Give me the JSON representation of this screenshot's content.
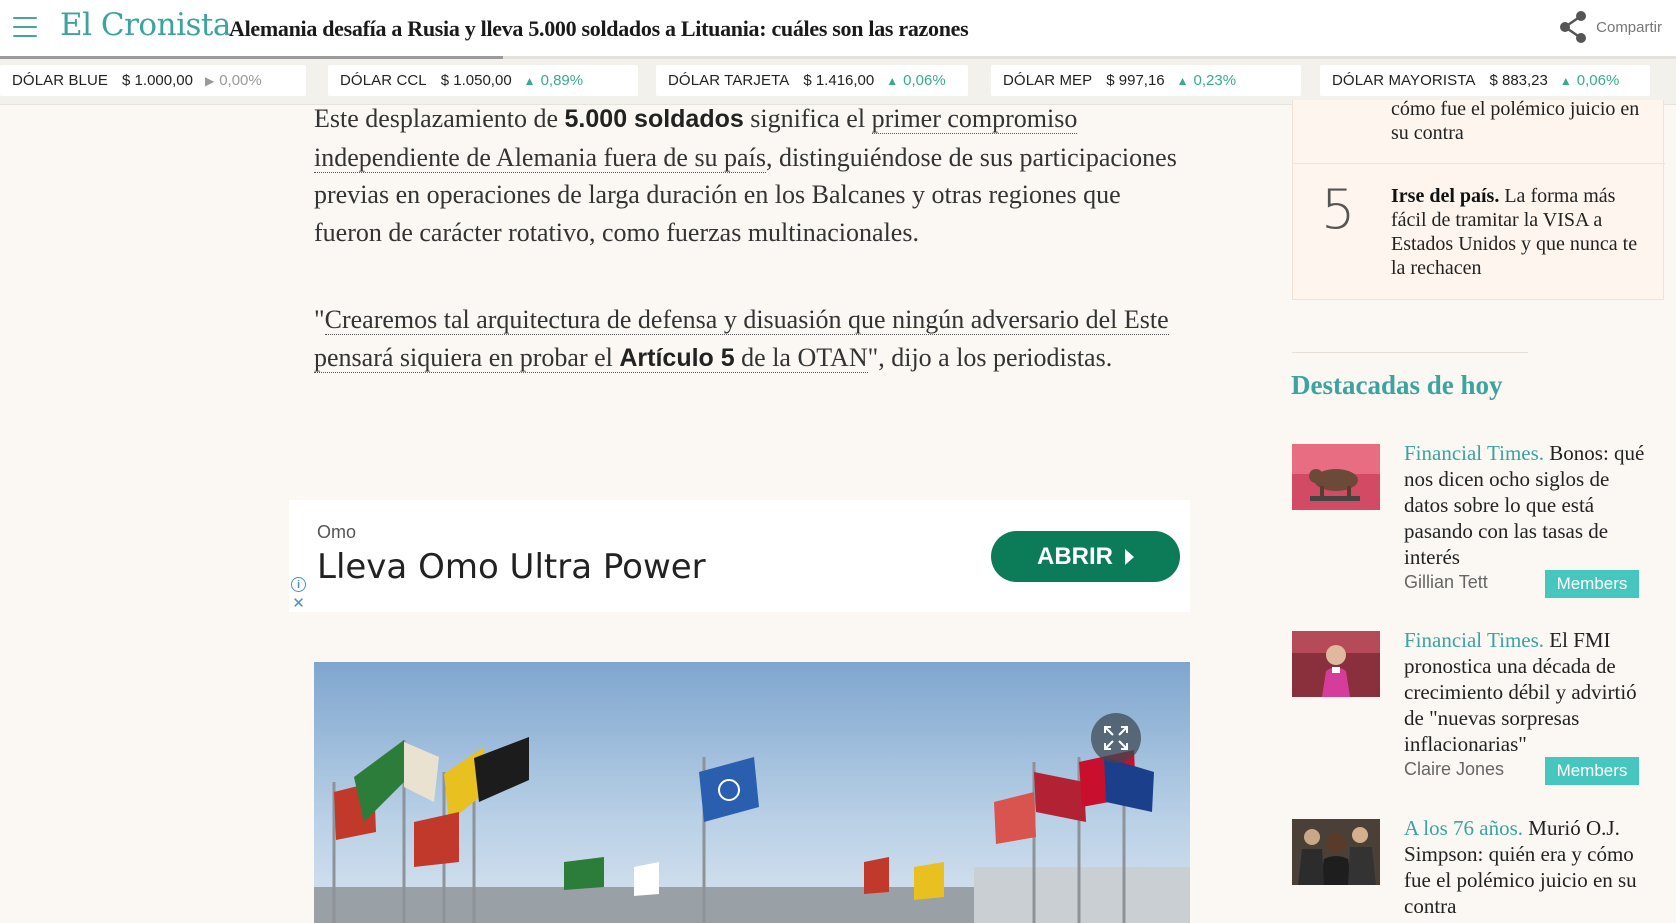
{
  "header": {
    "logo": "El Cronista",
    "headline": "Alemania desafía a Rusia y lleva 5.000 soldados a Lituania: cuáles son las razones",
    "share_label": "Compartir",
    "reading_progress_percent": 30
  },
  "ticker": [
    {
      "name": "DÓLAR BLUE",
      "value": "$ 1.000,00",
      "change": "0,00%",
      "direction": "flat"
    },
    {
      "name": "DÓLAR CCL",
      "value": "$ 1.050,00",
      "change": "0,89%",
      "direction": "up"
    },
    {
      "name": "DÓLAR TARJETA",
      "value": "$ 1.416,00",
      "change": "0,06%",
      "direction": "up"
    },
    {
      "name": "DÓLAR MEP",
      "value": "$ 997,16",
      "change": "0,23%",
      "direction": "up"
    },
    {
      "name": "DÓLAR MAYORISTA",
      "value": "$ 883,23",
      "change": "0,06%",
      "direction": "up"
    }
  ],
  "article": {
    "p1_a": "Este desplazamiento de ",
    "p1_b": "5.000 soldados",
    "p1_c": " significa el ",
    "p1_link": "primer compromiso independiente de Alemania fuera de su país",
    "p1_d": ", distinguiéndose de sus participaciones previas en operaciones de larga duración en los Balcanes y otras regiones que fueron de carácter rotativo, como fuerzas multinacionales.",
    "p2_q": "\"",
    "p2_link_a": "Crearemos tal arquitectura de defensa y disuasión que ningún adversario del Este pensará siquiera en probar el ",
    "p2_link_b": "Artículo 5",
    "p2_link_c": " de la OTAN",
    "p2_d": "\", dijo a los periodistas."
  },
  "ad": {
    "brand": "Omo",
    "title": "Lleva Omo Ultra Power",
    "button": "ABRIR",
    "info": "i",
    "close": "✕"
  },
  "sidebar": {
    "prev_item_tail": "cómo fue el polémico juicio en su contra",
    "item5_number": "5",
    "item5_bold": "Irse del país.",
    "item5_text": " La forma más fácil de tramitar la VISA a Estados Unidos y que nunca te la rechacen",
    "destacadas_title": "Destacadas de hoy",
    "stories": [
      {
        "source": "Financial Times.",
        "text": " Bonos: qué nos dicen ocho siglos de datos sobre lo que está pasando con las tasas de interés",
        "author": "Gillian Tett",
        "badge": "Members"
      },
      {
        "source": "Financial Times.",
        "text": " El FMI pronostica una década de crecimiento débil y advirtió de \"nuevas sorpresas inflacionarias\"",
        "author": "Claire Jones",
        "badge": "Members"
      },
      {
        "source": "A los 76 años.",
        "text": " Murió O.J. Simpson: quién era y cómo fue el polémico juicio en su contra"
      }
    ]
  },
  "colors": {
    "brand_teal": "#3ca39f",
    "ticker_up": "#3aaa8e",
    "ad_button": "#0c7c58",
    "members_badge": "#47c6bf"
  },
  "icons": [
    "menu-icon",
    "share-icon",
    "expand-icon",
    "ad-info-icon",
    "ad-close-icon"
  ]
}
